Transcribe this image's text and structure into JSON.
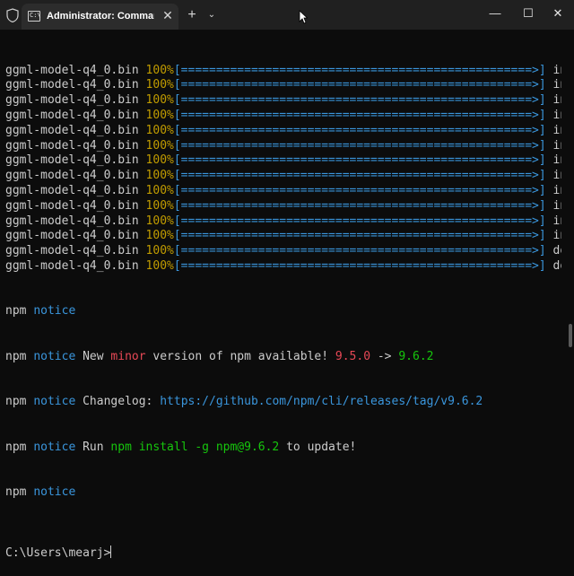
{
  "window": {
    "tab_title": "Administrator: Command Pro",
    "tab_icon_text": "C:\\",
    "close_tab": "✕",
    "new_tab": "+",
    "dropdown": "⌄",
    "minimize": "—",
    "maximize": "☐",
    "close": "✕"
  },
  "terminal": {
    "progress_lines": [
      {
        "file": "ggml-model-q4_0.bin",
        "percent": "100%",
        "bar": "[==================================================>]",
        "suffix": "in"
      },
      {
        "file": "ggml-model-q4_0.bin",
        "percent": "100%",
        "bar": "[==================================================>]",
        "suffix": "in"
      },
      {
        "file": "ggml-model-q4_0.bin",
        "percent": "100%",
        "bar": "[==================================================>]",
        "suffix": "in"
      },
      {
        "file": "ggml-model-q4_0.bin",
        "percent": "100%",
        "bar": "[==================================================>]",
        "suffix": "in"
      },
      {
        "file": "ggml-model-q4_0.bin",
        "percent": "100%",
        "bar": "[==================================================>]",
        "suffix": "in"
      },
      {
        "file": "ggml-model-q4_0.bin",
        "percent": "100%",
        "bar": "[==================================================>]",
        "suffix": "in"
      },
      {
        "file": "ggml-model-q4_0.bin",
        "percent": "100%",
        "bar": "[==================================================>]",
        "suffix": "in"
      },
      {
        "file": "ggml-model-q4_0.bin",
        "percent": "100%",
        "bar": "[==================================================>]",
        "suffix": "in"
      },
      {
        "file": "ggml-model-q4_0.bin",
        "percent": "100%",
        "bar": "[==================================================>]",
        "suffix": "in"
      },
      {
        "file": "ggml-model-q4_0.bin",
        "percent": "100%",
        "bar": "[==================================================>]",
        "suffix": "in"
      },
      {
        "file": "ggml-model-q4_0.bin",
        "percent": "100%",
        "bar": "[==================================================>]",
        "suffix": "in"
      },
      {
        "file": "ggml-model-q4_0.bin",
        "percent": "100%",
        "bar": "[==================================================>]",
        "suffix": "in"
      },
      {
        "file": "ggml-model-q4_0.bin",
        "percent": "100%",
        "bar": "[==================================================>]",
        "suffix": "don"
      },
      {
        "file": "ggml-model-q4_0.bin",
        "percent": "100%",
        "bar": "[==================================================>]",
        "suffix": "don"
      }
    ],
    "npm": {
      "prefix": "npm",
      "notice": "notice",
      "l2_a": "New",
      "l2_minor": "minor",
      "l2_b": "version of npm available!",
      "l2_old": "9.5.0",
      "l2_arrow": "->",
      "l2_new": "9.6.2",
      "l3_a": "Changelog:",
      "l3_url": "https://github.com/npm/cli/releases/tag/v9.6.2",
      "l4_a": "Run",
      "l4_cmd": "npm install -g npm@9.6.2",
      "l4_b": "to update!"
    },
    "prompt": "C:\\Users\\mearj>"
  },
  "colors": {
    "background": "#0c0c0c",
    "text": "#cccccc",
    "percent": "#c19c00",
    "bar": "#3a96dd",
    "notice": "#3a96dd",
    "old_version": "#e74856",
    "new_version": "#16c60c",
    "command": "#16c60c"
  }
}
